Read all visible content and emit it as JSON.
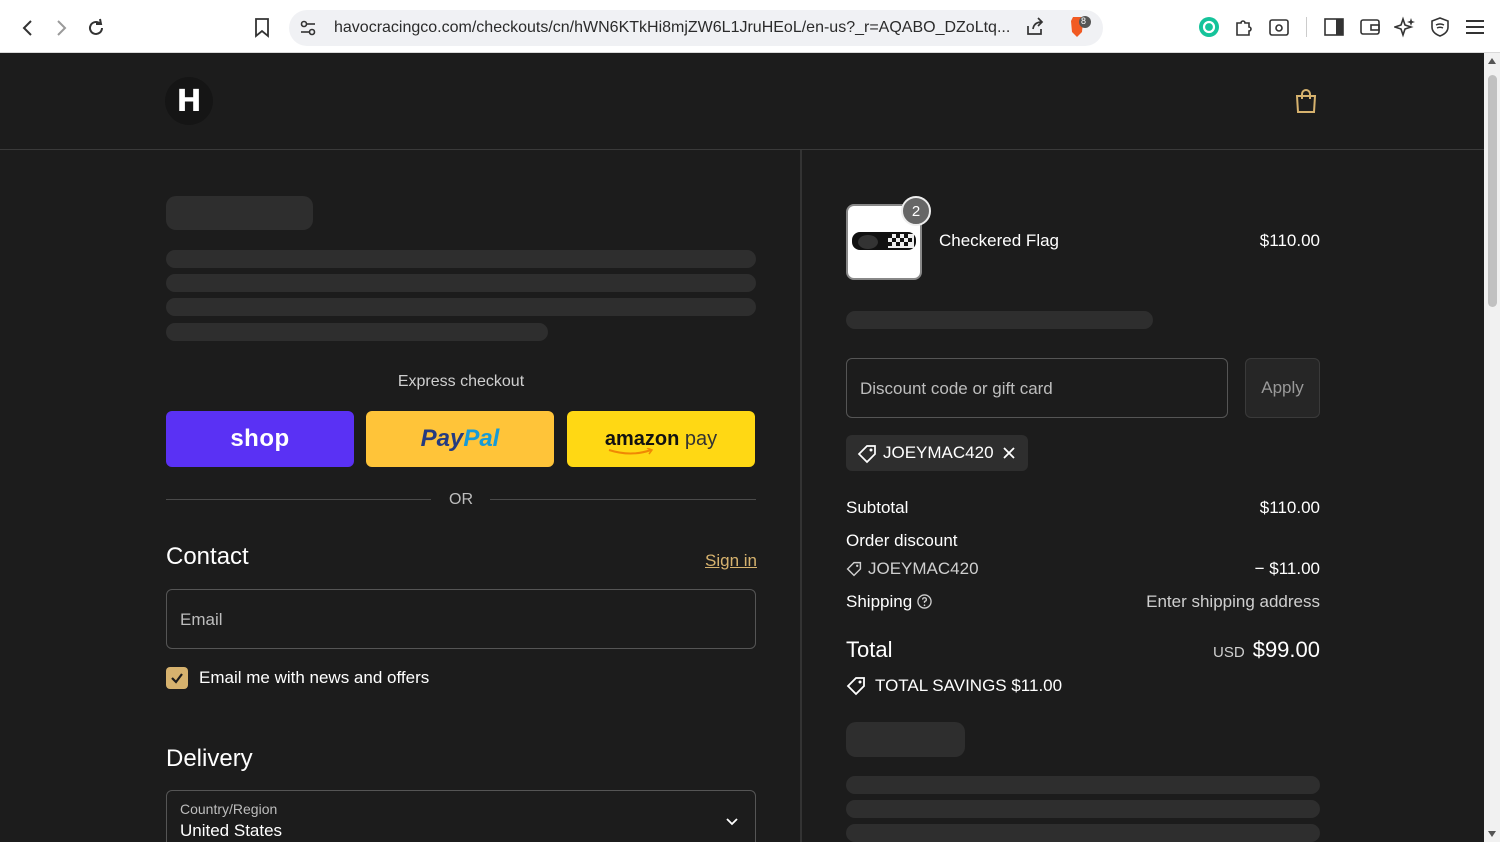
{
  "browser": {
    "url": "havocracingco.com/checkouts/cn/hWN6KTkHi8mjZW6L1JruHEoL/en-us?_r=AQABO_DZoLtq...",
    "shield_badge": "8"
  },
  "header": {
    "logo_text": "H"
  },
  "express": {
    "label": "Express checkout",
    "shop_label": "shop",
    "paypal_label_a": "Pay",
    "paypal_label_b": "Pal",
    "amazon_label_a": "amazon",
    "amazon_label_b": " pay",
    "or_label": "OR"
  },
  "contact": {
    "title": "Contact",
    "sign_in": "Sign in",
    "email_placeholder": "Email",
    "newsletter_label": "Email me with news and offers",
    "newsletter_checked": true
  },
  "delivery": {
    "title": "Delivery",
    "country_label": "Country/Region",
    "country_value": "United States"
  },
  "summary": {
    "product": {
      "name": "Checkered Flag",
      "price": "$110.00",
      "quantity": "2"
    },
    "discount_placeholder": "Discount code or gift card",
    "apply_label": "Apply",
    "applied_code": "JOEYMAC420",
    "subtotal_label": "Subtotal",
    "subtotal_value": "$110.00",
    "order_discount_label": "Order discount",
    "discount_code": "JOEYMAC420",
    "discount_value": "− $11.00",
    "shipping_label": "Shipping",
    "shipping_value": "Enter shipping address",
    "total_label": "Total",
    "total_currency": "USD",
    "total_value": "$99.00",
    "savings_label": "TOTAL SAVINGS  $11.00"
  },
  "colors": {
    "accent": "#d6b26e",
    "shop": "#5a31f4",
    "paypal": "#ffc439",
    "amazon": "#ffd814"
  }
}
